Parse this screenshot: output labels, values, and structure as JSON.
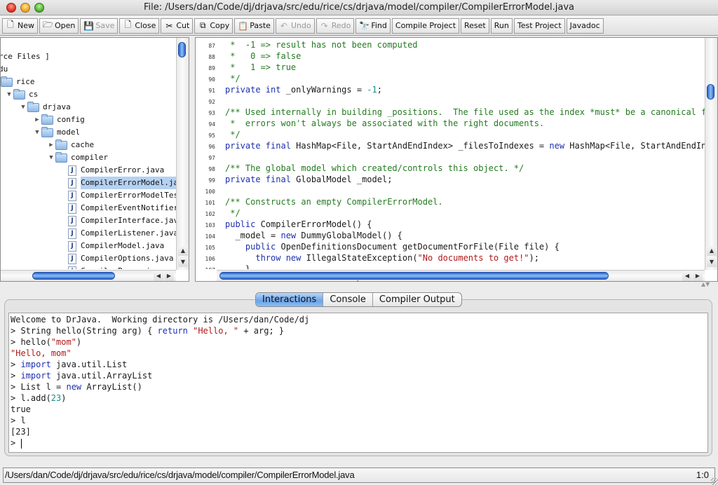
{
  "window": {
    "title": "File: /Users/dan/Code/dj/drjava/src/edu/rice/cs/drjava/model/compiler/CompilerErrorModel.java"
  },
  "toolbar": {
    "buttons": [
      {
        "label": "New",
        "icon": "new-file-icon",
        "glyph": "🗋",
        "enabled": true
      },
      {
        "label": "Open",
        "icon": "open-folder-icon",
        "glyph": "🗁",
        "enabled": true
      },
      {
        "label": "Save",
        "icon": "save-disk-icon",
        "glyph": "💾",
        "enabled": false
      },
      {
        "label": "Close",
        "icon": "close-file-icon",
        "glyph": "🗋",
        "enabled": true
      },
      {
        "label": "Cut",
        "icon": "scissors-icon",
        "glyph": "✂",
        "enabled": true
      },
      {
        "label": "Copy",
        "icon": "copy-icon",
        "glyph": "⧉",
        "enabled": true
      },
      {
        "label": "Paste",
        "icon": "clipboard-icon",
        "glyph": "📋",
        "enabled": true
      },
      {
        "label": "Undo",
        "icon": "undo-icon",
        "glyph": "↶",
        "enabled": false
      },
      {
        "label": "Redo",
        "icon": "redo-icon",
        "glyph": "↷",
        "enabled": false
      },
      {
        "label": "Find",
        "icon": "binoculars-icon",
        "glyph": "🔭",
        "enabled": true
      },
      {
        "label": "Compile Project",
        "icon": "",
        "glyph": "",
        "enabled": true
      },
      {
        "label": "Reset",
        "icon": "",
        "glyph": "",
        "enabled": true
      },
      {
        "label": "Run",
        "icon": "",
        "glyph": "",
        "enabled": true
      },
      {
        "label": "Test Project",
        "icon": "",
        "glyph": "",
        "enabled": true
      },
      {
        "label": "Javadoc",
        "icon": "",
        "glyph": "",
        "enabled": true
      }
    ]
  },
  "tree": {
    "items": [
      {
        "label": "rce Files ]",
        "type": "text",
        "depth": 0,
        "disclosure": ""
      },
      {
        "label": "du",
        "type": "text",
        "depth": 0,
        "disclosure": ""
      },
      {
        "label": "rice",
        "type": "folder",
        "depth": 0,
        "disclosure": ""
      },
      {
        "label": "cs",
        "type": "folder",
        "depth": 1,
        "disclosure": "▼"
      },
      {
        "label": "drjava",
        "type": "folder",
        "depth": 2,
        "disclosure": "▼"
      },
      {
        "label": "config",
        "type": "folder",
        "depth": 3,
        "disclosure": "▶"
      },
      {
        "label": "model",
        "type": "folder",
        "depth": 3,
        "disclosure": "▼"
      },
      {
        "label": "cache",
        "type": "folder",
        "depth": 4,
        "disclosure": "▶"
      },
      {
        "label": "compiler",
        "type": "folder",
        "depth": 4,
        "disclosure": "▼"
      },
      {
        "label": "CompilerError.java",
        "type": "file",
        "depth": 5,
        "selected": false
      },
      {
        "label": "CompilerErrorModel.java",
        "type": "file",
        "depth": 5,
        "selected": true
      },
      {
        "label": "CompilerErrorModelTest.java",
        "type": "file",
        "depth": 5,
        "selected": false
      },
      {
        "label": "CompilerEventNotifier.java",
        "type": "file",
        "depth": 5,
        "selected": false
      },
      {
        "label": "CompilerInterface.java",
        "type": "file",
        "depth": 5,
        "selected": false
      },
      {
        "label": "CompilerListener.java",
        "type": "file",
        "depth": 5,
        "selected": false
      },
      {
        "label": "CompilerModel.java",
        "type": "file",
        "depth": 5,
        "selected": false
      },
      {
        "label": "CompilerOptions.java",
        "type": "file",
        "depth": 5,
        "selected": false
      },
      {
        "label": "CompilerProxy.java",
        "type": "file",
        "depth": 5,
        "selected": false
      }
    ],
    "vscroll_position": 0.05,
    "hscroll_position": 0.3
  },
  "editor": {
    "lines": [
      {
        "n": "87",
        "tokens": [
          [
            "cm",
            " *  -1 => result has not been computed"
          ]
        ]
      },
      {
        "n": "88",
        "tokens": [
          [
            "cm",
            " *   0 => false"
          ]
        ]
      },
      {
        "n": "89",
        "tokens": [
          [
            "cm",
            " *   1 => true"
          ]
        ]
      },
      {
        "n": "90",
        "tokens": [
          [
            "cm",
            " */"
          ]
        ]
      },
      {
        "n": "91",
        "tokens": [
          [
            "kw",
            "private int"
          ],
          [
            "tx",
            " _onlyWarnings = "
          ],
          [
            "nm",
            "-1"
          ],
          [
            "tx",
            ";"
          ]
        ]
      },
      {
        "n": "92",
        "tokens": []
      },
      {
        "n": "93",
        "tokens": [
          [
            "cm",
            "/** Used internally in building _positions.  The file used as the index *must* be a canonical file"
          ]
        ]
      },
      {
        "n": "94",
        "tokens": [
          [
            "cm",
            " *  errors won't always be associated with the right documents."
          ]
        ]
      },
      {
        "n": "95",
        "tokens": [
          [
            "cm",
            " */"
          ]
        ]
      },
      {
        "n": "96",
        "tokens": [
          [
            "kw",
            "private final"
          ],
          [
            "tx",
            " HashMap<File, StartAndEndIndex> _filesToIndexes = "
          ],
          [
            "kw",
            "new"
          ],
          [
            "tx",
            " HashMap<File, StartAndEndIndex>"
          ]
        ]
      },
      {
        "n": "97",
        "tokens": []
      },
      {
        "n": "98",
        "tokens": [
          [
            "cm",
            "/** The global model which created/controls this object. */"
          ]
        ]
      },
      {
        "n": "99",
        "tokens": [
          [
            "kw",
            "private final"
          ],
          [
            "tx",
            " GlobalModel _model;"
          ]
        ]
      },
      {
        "n": "100",
        "tokens": []
      },
      {
        "n": "101",
        "tokens": [
          [
            "cm",
            "/** Constructs an empty CompilerErrorModel."
          ]
        ]
      },
      {
        "n": "102",
        "tokens": [
          [
            "cm",
            " */"
          ]
        ]
      },
      {
        "n": "103",
        "tokens": [
          [
            "kw",
            "public"
          ],
          [
            "tx",
            " CompilerErrorModel() {"
          ]
        ]
      },
      {
        "n": "104",
        "tokens": [
          [
            "tx",
            "  _model = "
          ],
          [
            "kw",
            "new"
          ],
          [
            "tx",
            " DummyGlobalModel() {"
          ]
        ]
      },
      {
        "n": "105",
        "tokens": [
          [
            "kw",
            "    public"
          ],
          [
            "tx",
            " OpenDefinitionsDocument getDocumentForFile(File file) {"
          ]
        ]
      },
      {
        "n": "106",
        "tokens": [
          [
            "kw",
            "      throw new"
          ],
          [
            "tx",
            " IllegalStateException("
          ],
          [
            "st",
            "\"No documents to get!\""
          ],
          [
            "tx",
            ");"
          ]
        ]
      },
      {
        "n": "107",
        "tokens": [
          [
            "tx",
            "    }"
          ]
        ]
      }
    ],
    "vscroll_position": 0.28,
    "hscroll_position": 0.0
  },
  "tabs": {
    "items": [
      {
        "label": "Interactions",
        "active": true
      },
      {
        "label": "Console",
        "active": false
      },
      {
        "label": "Compiler Output",
        "active": false
      }
    ]
  },
  "interactions": {
    "lines": [
      [
        [
          "tx",
          "Welcome to DrJava.  Working directory is /Users/dan/Code/dj"
        ]
      ],
      [
        [
          "tx",
          "> String hello(String arg) { "
        ],
        [
          "kw",
          "return"
        ],
        [
          "st",
          " \"Hello, \""
        ],
        [
          "tx",
          " + arg; }"
        ]
      ],
      [
        [
          "tx",
          "> hello("
        ],
        [
          "st",
          "\"mom\""
        ],
        [
          "tx",
          ")"
        ]
      ],
      [
        [
          "st",
          "\"Hello, mom\""
        ]
      ],
      [
        [
          "tx",
          "> "
        ],
        [
          "kw",
          "import"
        ],
        [
          "tx",
          " java.util.List"
        ]
      ],
      [
        [
          "tx",
          "> "
        ],
        [
          "kw",
          "import"
        ],
        [
          "tx",
          " java.util.ArrayList"
        ]
      ],
      [
        [
          "tx",
          "> List l = "
        ],
        [
          "kw",
          "new"
        ],
        [
          "tx",
          " ArrayList()"
        ]
      ],
      [
        [
          "tx",
          "> l.add("
        ],
        [
          "nm",
          "23"
        ],
        [
          "tx",
          ")"
        ]
      ],
      [
        [
          "tx",
          "true"
        ]
      ],
      [
        [
          "tx",
          "> l"
        ]
      ],
      [
        [
          "tx",
          "[23]"
        ]
      ],
      [
        [
          "tx",
          "> "
        ]
      ]
    ]
  },
  "status": {
    "path": "/Users/dan/Code/dj/drjava/src/edu/rice/cs/drjava/model/compiler/CompilerErrorModel.java",
    "position": "1:0"
  }
}
